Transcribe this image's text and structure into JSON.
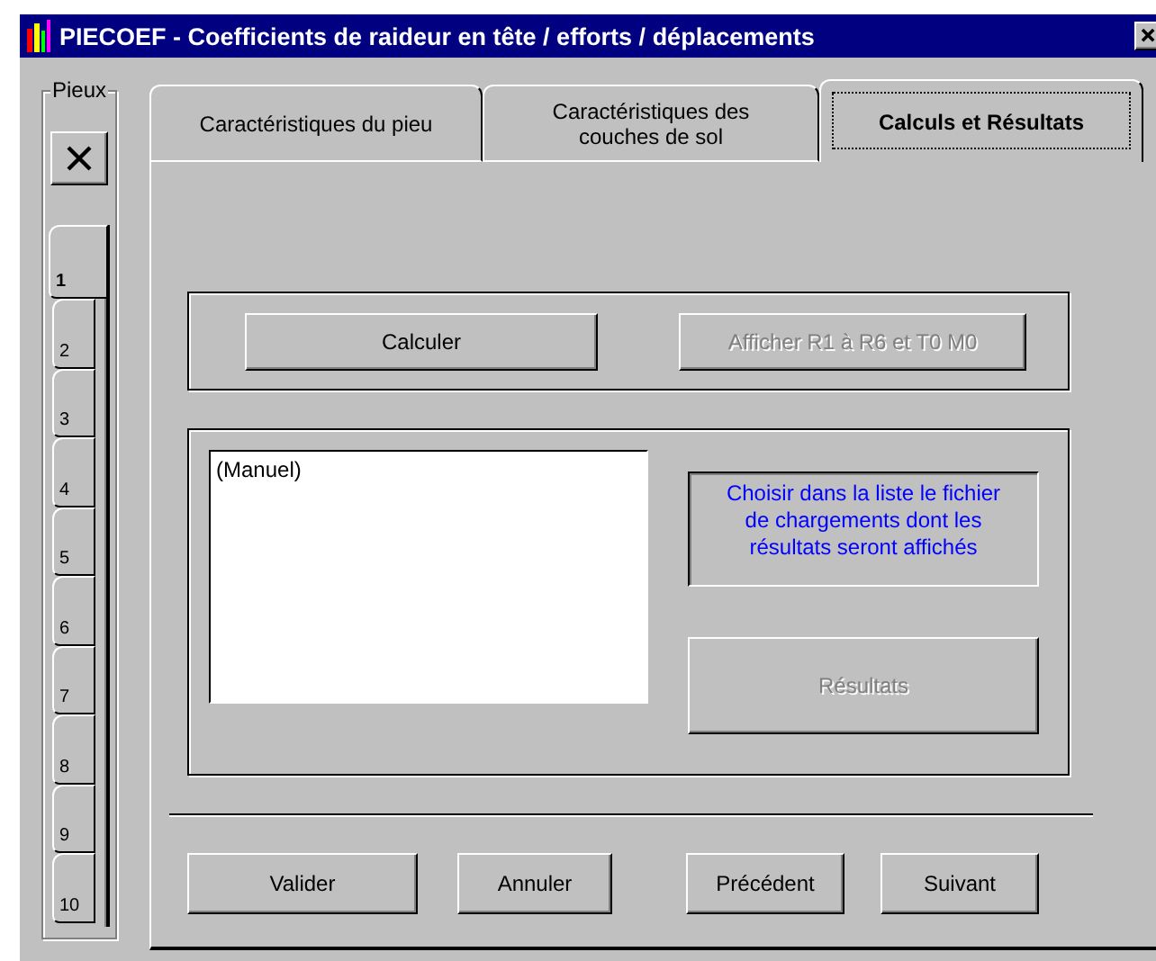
{
  "window": {
    "title": "PIECOEF - Coefficients de raideur en tête / efforts / déplacements"
  },
  "piles": {
    "label": "Pieux",
    "tabs": [
      {
        "label": "1",
        "selected": true
      },
      {
        "label": "2",
        "selected": false
      },
      {
        "label": "3",
        "selected": false
      },
      {
        "label": "4",
        "selected": false
      },
      {
        "label": "5",
        "selected": false
      },
      {
        "label": "6",
        "selected": false
      },
      {
        "label": "7",
        "selected": false
      },
      {
        "label": "8",
        "selected": false
      },
      {
        "label": "9",
        "selected": false
      },
      {
        "label": "10",
        "selected": false
      }
    ]
  },
  "tabs": [
    {
      "label": "Caractéristiques du pieu",
      "selected": false
    },
    {
      "label": "Caractéristiques des couches de sol",
      "selected": false
    },
    {
      "label": "Calculs et Résultats",
      "selected": true
    }
  ],
  "calc_buttons": [
    {
      "label": "Calculer",
      "disabled": false
    },
    {
      "label": "Afficher R1 à R6 et T0 M0",
      "disabled": true
    }
  ],
  "load_files": [
    "(Manuel)"
  ],
  "hint": "Choisir dans la liste le fichier de chargements dont les résultats seront affichés",
  "results_button": {
    "label": "Résultats",
    "disabled": true
  },
  "footer_buttons": [
    {
      "label": "Valider"
    },
    {
      "label": "Annuler"
    },
    {
      "label": "Précédent"
    },
    {
      "label": "Suivant"
    }
  ]
}
